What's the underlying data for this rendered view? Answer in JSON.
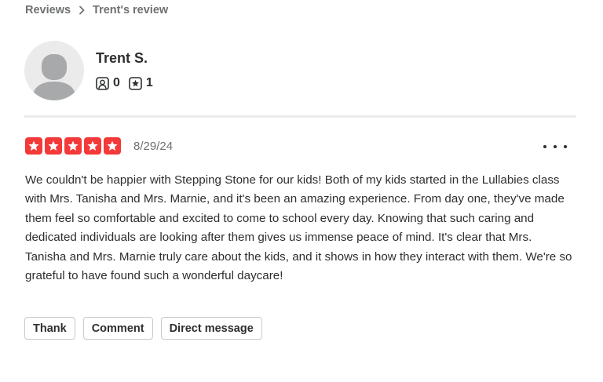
{
  "breadcrumb": {
    "parent": "Reviews",
    "current": "Trent's review"
  },
  "user": {
    "name": "Trent S.",
    "friends_count": "0",
    "reviews_count": "1"
  },
  "review": {
    "rating": 5,
    "date": "8/29/24",
    "text": "We couldn't be happier with Stepping Stone for our kids! Both of my kids started in the Lullabies class with Mrs. Tanisha and Mrs. Marnie, and it's been an amazing experience. From day one, they've made them feel so comfortable and excited to come to school every day. Knowing that such caring and dedicated individuals are looking after them gives us immense peace of mind. It's clear that Mrs. Tanisha and Mrs. Marnie truly care about the kids, and it shows in how they interact with them. We're so grateful to have found such a wonderful daycare!"
  },
  "actions": {
    "thank_label": "Thank",
    "comment_label": "Comment",
    "message_label": "Direct message"
  },
  "colors": {
    "star_red": "#f43939",
    "text": "#2d2e2f",
    "muted": "#6e7072"
  },
  "icons": {
    "breadcrumb_separator": "chevron-right-icon",
    "friends": "friends-icon",
    "reviews": "review-star-icon",
    "more": "more-horizontal-icon"
  }
}
